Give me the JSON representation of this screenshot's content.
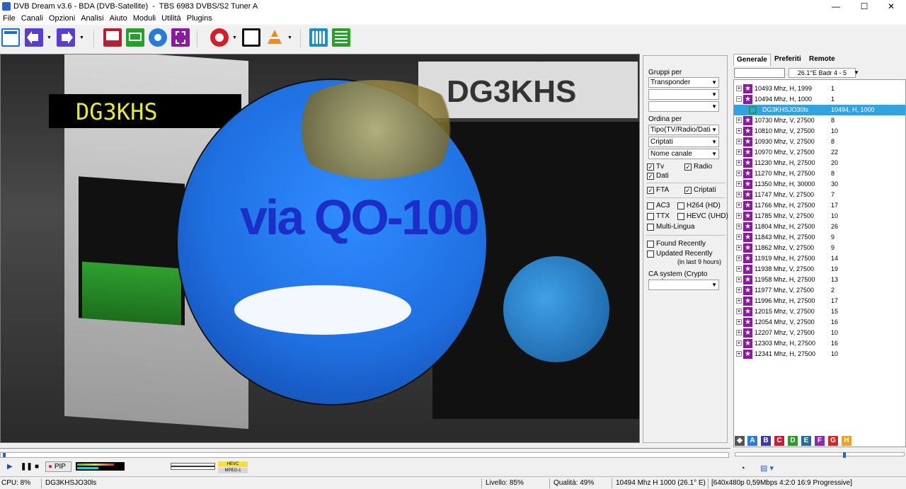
{
  "window": {
    "title": "DVB Dream v3.6 - BDA (DVB-Satellite)  -  TBS 6983 DVBS/S2 Tuner A",
    "minimize": "—",
    "maximize": "☐",
    "close": "✕"
  },
  "menu": [
    "File",
    "Canali",
    "Opzioni",
    "Analisi",
    "Aiuto",
    "Moduli",
    "Utilità",
    "Plugins"
  ],
  "video": {
    "callsign_box": "DG3KHS",
    "globe_text": "via QO-100",
    "bg_sign": "DG3KHS"
  },
  "options": {
    "gruppi_label": "Gruppi per",
    "gruppi_values": [
      "Transponder",
      "",
      ""
    ],
    "ordina_label": "Ordina per",
    "ordina_values": [
      "Tipo(TV/Radio/Dati",
      "Criptati",
      "Nome canale"
    ],
    "tv": "Tv",
    "radio": "Radio",
    "dati": "Dati",
    "fta": "FTA",
    "criptati": "Criptati",
    "ac3": "AC3",
    "h264": "H264 (HD)",
    "ttx": "TTX",
    "hevc": "HEVC (UHD)",
    "multilingua": "Multi-Lingua",
    "found_recently": "Found Recently",
    "updated_recently": "Updated Recently",
    "updated_hint": "(in last 9 hours)",
    "ca_label": "CA system (Crypto type):",
    "ca_value": ""
  },
  "panel": {
    "tabs": [
      "Generale",
      "Preferiti",
      "Remote"
    ],
    "search_value": "",
    "satellite": "26.1°E Badr 4 - 5",
    "rows": [
      {
        "freq": "10493 Mhz, H, 1999",
        "count": "1",
        "exp": "+"
      },
      {
        "freq": "10494 Mhz, H, 1000",
        "count": "1",
        "exp": "−"
      },
      {
        "channel": "DG3KHSJO30ls",
        "info": "10494, H, 1000"
      },
      {
        "freq": "10730 Mhz, V, 27500",
        "count": "8",
        "exp": "+"
      },
      {
        "freq": "10810 Mhz, V, 27500",
        "count": "10",
        "exp": "+"
      },
      {
        "freq": "10930 Mhz, V, 27500",
        "count": "8",
        "exp": "+"
      },
      {
        "freq": "10970 Mhz, V, 27500",
        "count": "22",
        "exp": "+"
      },
      {
        "freq": "11230 Mhz, H, 27500",
        "count": "20",
        "exp": "+"
      },
      {
        "freq": "11270 Mhz, H, 27500",
        "count": "8",
        "exp": "+"
      },
      {
        "freq": "11350 Mhz, H, 30000",
        "count": "30",
        "exp": "+"
      },
      {
        "freq": "11747 Mhz, V, 27500",
        "count": "7",
        "exp": "+"
      },
      {
        "freq": "11766 Mhz, H, 27500",
        "count": "17",
        "exp": "+"
      },
      {
        "freq": "11785 Mhz, V, 27500",
        "count": "10",
        "exp": "+"
      },
      {
        "freq": "11804 Mhz, H, 27500",
        "count": "26",
        "exp": "+"
      },
      {
        "freq": "11843 Mhz, H, 27500",
        "count": "9",
        "exp": "+"
      },
      {
        "freq": "11862 Mhz, V, 27500",
        "count": "9",
        "exp": "+"
      },
      {
        "freq": "11919 Mhz, H, 27500",
        "count": "14",
        "exp": "+"
      },
      {
        "freq": "11938 Mhz, V, 27500",
        "count": "19",
        "exp": "+"
      },
      {
        "freq": "11958 Mhz, H, 27500",
        "count": "13",
        "exp": "+"
      },
      {
        "freq": "11977 Mhz, V, 27500",
        "count": "2",
        "exp": "+"
      },
      {
        "freq": "11996 Mhz, H, 27500",
        "count": "17",
        "exp": "+"
      },
      {
        "freq": "12015 Mhz, V, 27500",
        "count": "15",
        "exp": "+"
      },
      {
        "freq": "12054 Mhz, V, 27500",
        "count": "16",
        "exp": "+"
      },
      {
        "freq": "12207 Mhz, V, 27500",
        "count": "10",
        "exp": "+"
      },
      {
        "freq": "12303 Mhz, H, 27500",
        "count": "16",
        "exp": "+"
      },
      {
        "freq": "12341 Mhz, H, 27500",
        "count": "10",
        "exp": "+"
      }
    ],
    "favorites": [
      {
        "label": "A",
        "color": "#2e7bd6"
      },
      {
        "label": "B",
        "color": "#3a3aa8"
      },
      {
        "label": "C",
        "color": "#c0203a"
      },
      {
        "label": "D",
        "color": "#2a9a2a"
      },
      {
        "label": "E",
        "color": "#1f6f9a"
      },
      {
        "label": "F",
        "color": "#8a2bb0"
      },
      {
        "label": "G",
        "color": "#d02828"
      },
      {
        "label": "H",
        "color": "#f0a020"
      }
    ]
  },
  "playback": {
    "pip": "PIP",
    "codec_top": "HEVC",
    "codec_bottom": "MPEG-1"
  },
  "status": {
    "cpu": "CPU: 8%",
    "channel": "DG3KHSJO30ls",
    "level": "Livello: 85%",
    "quality": "Qualità: 49%",
    "tuning": "10494 Mhz  H  1000  (26.1° E)",
    "video_info": "[640x480p  0,59Mbps 4:2:0  16:9 Progressive]"
  },
  "colors": {
    "selected_row": "#33a3e0",
    "star_icon": "#8a1b9c",
    "globe": "#1f6fe0",
    "callsign_text": "#e8e840"
  }
}
